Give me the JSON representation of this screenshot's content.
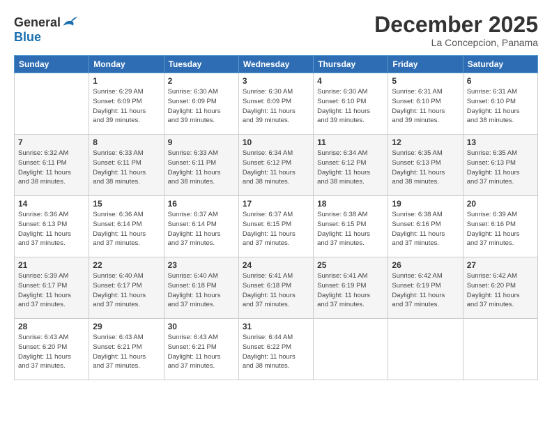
{
  "header": {
    "logo_general": "General",
    "logo_blue": "Blue",
    "month_title": "December 2025",
    "location": "La Concepcion, Panama"
  },
  "days_of_week": [
    "Sunday",
    "Monday",
    "Tuesday",
    "Wednesday",
    "Thursday",
    "Friday",
    "Saturday"
  ],
  "weeks": [
    [
      {
        "day": "",
        "info": ""
      },
      {
        "day": "1",
        "info": "Sunrise: 6:29 AM\nSunset: 6:09 PM\nDaylight: 11 hours\nand 39 minutes."
      },
      {
        "day": "2",
        "info": "Sunrise: 6:30 AM\nSunset: 6:09 PM\nDaylight: 11 hours\nand 39 minutes."
      },
      {
        "day": "3",
        "info": "Sunrise: 6:30 AM\nSunset: 6:09 PM\nDaylight: 11 hours\nand 39 minutes."
      },
      {
        "day": "4",
        "info": "Sunrise: 6:30 AM\nSunset: 6:10 PM\nDaylight: 11 hours\nand 39 minutes."
      },
      {
        "day": "5",
        "info": "Sunrise: 6:31 AM\nSunset: 6:10 PM\nDaylight: 11 hours\nand 39 minutes."
      },
      {
        "day": "6",
        "info": "Sunrise: 6:31 AM\nSunset: 6:10 PM\nDaylight: 11 hours\nand 38 minutes."
      }
    ],
    [
      {
        "day": "7",
        "info": "Sunrise: 6:32 AM\nSunset: 6:11 PM\nDaylight: 11 hours\nand 38 minutes."
      },
      {
        "day": "8",
        "info": "Sunrise: 6:33 AM\nSunset: 6:11 PM\nDaylight: 11 hours\nand 38 minutes."
      },
      {
        "day": "9",
        "info": "Sunrise: 6:33 AM\nSunset: 6:11 PM\nDaylight: 11 hours\nand 38 minutes."
      },
      {
        "day": "10",
        "info": "Sunrise: 6:34 AM\nSunset: 6:12 PM\nDaylight: 11 hours\nand 38 minutes."
      },
      {
        "day": "11",
        "info": "Sunrise: 6:34 AM\nSunset: 6:12 PM\nDaylight: 11 hours\nand 38 minutes."
      },
      {
        "day": "12",
        "info": "Sunrise: 6:35 AM\nSunset: 6:13 PM\nDaylight: 11 hours\nand 38 minutes."
      },
      {
        "day": "13",
        "info": "Sunrise: 6:35 AM\nSunset: 6:13 PM\nDaylight: 11 hours\nand 37 minutes."
      }
    ],
    [
      {
        "day": "14",
        "info": "Sunrise: 6:36 AM\nSunset: 6:13 PM\nDaylight: 11 hours\nand 37 minutes."
      },
      {
        "day": "15",
        "info": "Sunrise: 6:36 AM\nSunset: 6:14 PM\nDaylight: 11 hours\nand 37 minutes."
      },
      {
        "day": "16",
        "info": "Sunrise: 6:37 AM\nSunset: 6:14 PM\nDaylight: 11 hours\nand 37 minutes."
      },
      {
        "day": "17",
        "info": "Sunrise: 6:37 AM\nSunset: 6:15 PM\nDaylight: 11 hours\nand 37 minutes."
      },
      {
        "day": "18",
        "info": "Sunrise: 6:38 AM\nSunset: 6:15 PM\nDaylight: 11 hours\nand 37 minutes."
      },
      {
        "day": "19",
        "info": "Sunrise: 6:38 AM\nSunset: 6:16 PM\nDaylight: 11 hours\nand 37 minutes."
      },
      {
        "day": "20",
        "info": "Sunrise: 6:39 AM\nSunset: 6:16 PM\nDaylight: 11 hours\nand 37 minutes."
      }
    ],
    [
      {
        "day": "21",
        "info": "Sunrise: 6:39 AM\nSunset: 6:17 PM\nDaylight: 11 hours\nand 37 minutes."
      },
      {
        "day": "22",
        "info": "Sunrise: 6:40 AM\nSunset: 6:17 PM\nDaylight: 11 hours\nand 37 minutes."
      },
      {
        "day": "23",
        "info": "Sunrise: 6:40 AM\nSunset: 6:18 PM\nDaylight: 11 hours\nand 37 minutes."
      },
      {
        "day": "24",
        "info": "Sunrise: 6:41 AM\nSunset: 6:18 PM\nDaylight: 11 hours\nand 37 minutes."
      },
      {
        "day": "25",
        "info": "Sunrise: 6:41 AM\nSunset: 6:19 PM\nDaylight: 11 hours\nand 37 minutes."
      },
      {
        "day": "26",
        "info": "Sunrise: 6:42 AM\nSunset: 6:19 PM\nDaylight: 11 hours\nand 37 minutes."
      },
      {
        "day": "27",
        "info": "Sunrise: 6:42 AM\nSunset: 6:20 PM\nDaylight: 11 hours\nand 37 minutes."
      }
    ],
    [
      {
        "day": "28",
        "info": "Sunrise: 6:43 AM\nSunset: 6:20 PM\nDaylight: 11 hours\nand 37 minutes."
      },
      {
        "day": "29",
        "info": "Sunrise: 6:43 AM\nSunset: 6:21 PM\nDaylight: 11 hours\nand 37 minutes."
      },
      {
        "day": "30",
        "info": "Sunrise: 6:43 AM\nSunset: 6:21 PM\nDaylight: 11 hours\nand 37 minutes."
      },
      {
        "day": "31",
        "info": "Sunrise: 6:44 AM\nSunset: 6:22 PM\nDaylight: 11 hours\nand 38 minutes."
      },
      {
        "day": "",
        "info": ""
      },
      {
        "day": "",
        "info": ""
      },
      {
        "day": "",
        "info": ""
      }
    ]
  ]
}
